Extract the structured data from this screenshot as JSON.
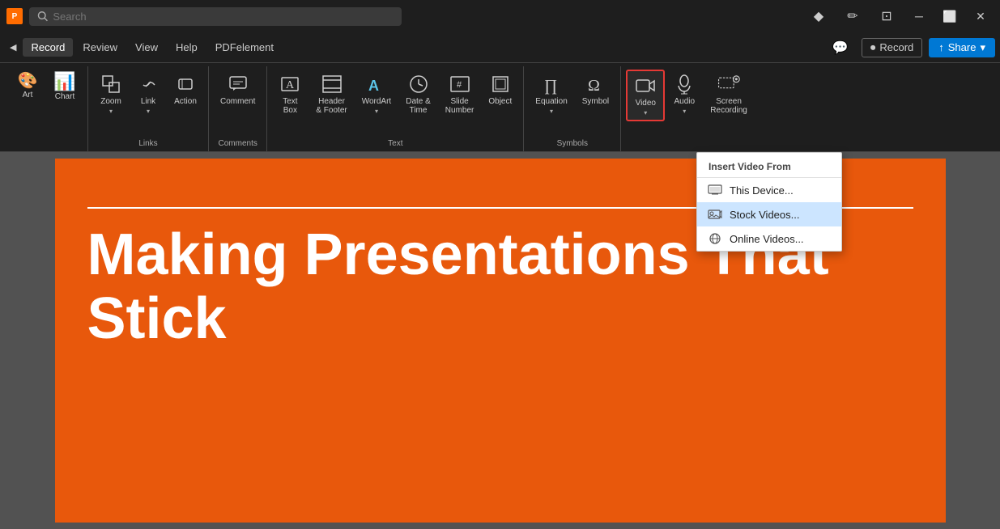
{
  "titlebar": {
    "search_placeholder": "Search"
  },
  "menubar": {
    "items": [
      "Record",
      "Review",
      "View",
      "Help",
      "PDFelement"
    ],
    "record_label": "Record",
    "share_label": "Share",
    "record_icon": "⏺",
    "share_icon": "↑"
  },
  "ribbon": {
    "groups": [
      {
        "label": "Links",
        "items": [
          {
            "id": "chart",
            "icon": "📊",
            "label": "Chart"
          },
          {
            "id": "zoom",
            "icon": "🔍",
            "label": "Zoom"
          },
          {
            "id": "link",
            "icon": "🔗",
            "label": "Link"
          },
          {
            "id": "action",
            "icon": "⚡",
            "label": "Action"
          }
        ]
      },
      {
        "label": "Comments",
        "items": [
          {
            "id": "comment",
            "icon": "💬",
            "label": "Comment"
          }
        ]
      },
      {
        "label": "Text",
        "items": [
          {
            "id": "textbox",
            "icon": "A",
            "label": "Text Box"
          },
          {
            "id": "headerfooter",
            "icon": "⊟",
            "label": "Header & Footer"
          },
          {
            "id": "wordart",
            "icon": "A",
            "label": "WordArt"
          },
          {
            "id": "datetime",
            "icon": "⏰",
            "label": "Date & Time"
          },
          {
            "id": "slidenumber",
            "icon": "#",
            "label": "Slide Number"
          },
          {
            "id": "object",
            "icon": "□",
            "label": "Object"
          }
        ]
      },
      {
        "label": "Symbols",
        "items": [
          {
            "id": "equation",
            "icon": "∏",
            "label": "Equation"
          },
          {
            "id": "symbol",
            "icon": "Ω",
            "label": "Symbol"
          }
        ]
      },
      {
        "label": "",
        "items": [
          {
            "id": "video",
            "icon": "▶",
            "label": "Video",
            "active": true
          },
          {
            "id": "audio",
            "icon": "🔊",
            "label": "Audio"
          },
          {
            "id": "screenrecording",
            "icon": "⏺",
            "label": "Screen Recording"
          }
        ]
      }
    ]
  },
  "dropdown": {
    "header": "Insert Video From",
    "items": [
      {
        "id": "thisdevice",
        "label": "This Device...",
        "highlighted": false
      },
      {
        "id": "stockvideos",
        "label": "Stock Videos...",
        "highlighted": true
      },
      {
        "id": "onlinevideos",
        "label": "Online Videos...",
        "highlighted": false
      }
    ]
  },
  "slide": {
    "title": "Making Presentations That Stick"
  }
}
